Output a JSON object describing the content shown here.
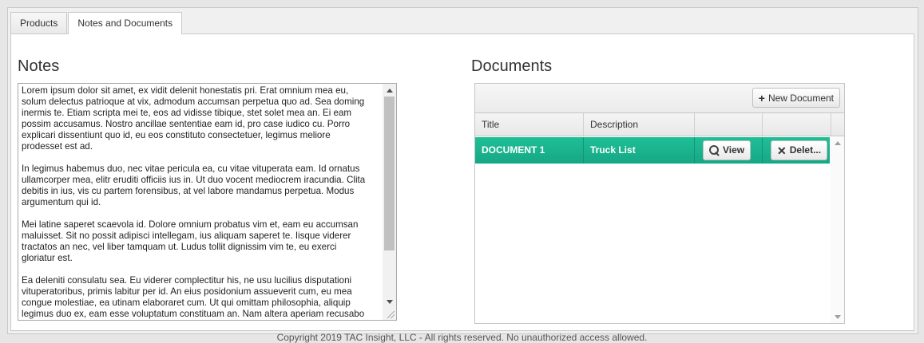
{
  "tabs": [
    {
      "label": "Products",
      "active": false
    },
    {
      "label": "Notes and Documents",
      "active": true
    }
  ],
  "notes": {
    "title": "Notes",
    "text": "Lorem ipsum dolor sit amet, ex vidit delenit honestatis pri. Erat omnium mea eu,\nsolum delectus patrioque at vix, admodum accumsan perpetua quo ad. Sea doming\ninermis te. Etiam scripta mei te, eos ad vidisse tibique, stet solet mea an. Ei eam\npossim accusamus. Nostro ancillae sententiae eam id, pro case iudico cu. Porro\nexplicari dissentiunt quo id, eu eos constituto consectetuer, legimus meliore\nprodesset est ad.\n\nIn legimus habemus duo, nec vitae pericula ea, cu vitae vituperata eam. Id ornatus\nullamcorper mea, elitr eruditi officiis ius in. Ut duo vocent mediocrem iracundia. Clita\ndebitis in ius, vis cu partem forensibus, at vel labore mandamus perpetua. Modus\nargumentum qui id.\n\nMei latine saperet scaevola id. Dolore omnium probatus vim et, eam eu accumsan\nmaluisset. Sit no possit adipisci intellegam, ius aliquam saperet te. Iisque viderer\ntractatos an nec, vel liber tamquam ut. Ludus tollit dignissim vim te, eu exerci\ngloriatur est.\n\nEa deleniti consulatu sea. Eu viderer complectitur his, ne usu lucilius disputationi\nvituperatoribus, primis labitur per id. An eius posidonium assueverit cum, eu mea\ncongue molestiae, ea utinam elaboraret cum. Ut qui omittam philosophia, aliquip\nlegimus duo ex, eam esse voluptatum constituam an. Nam altera aperiam recusabo"
  },
  "documents": {
    "title": "Documents",
    "new_button_label": "New Document",
    "columns": [
      "Title",
      "Description",
      "",
      ""
    ],
    "rows": [
      {
        "title": "DOCUMENT 1",
        "description": "Truck List",
        "view_label": "View",
        "delete_label": "Delet..."
      }
    ]
  },
  "footer": "Copyright 2019 TAC Insight, LLC - All rights reserved. No unauthorized access allowed.",
  "colors": {
    "selected_row": "#1ab38f",
    "panel_border": "#c9c9c9"
  }
}
